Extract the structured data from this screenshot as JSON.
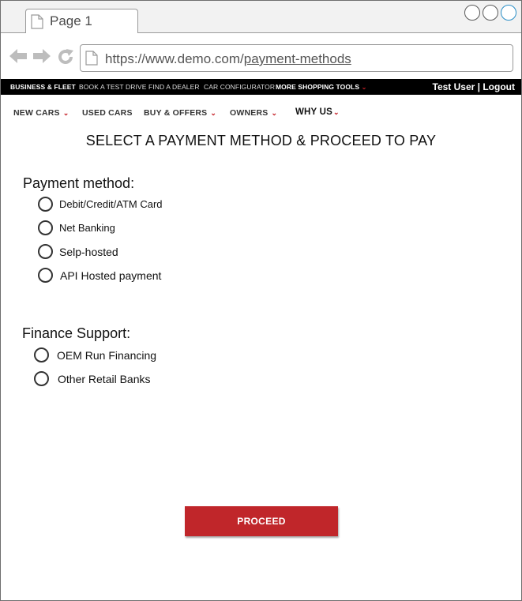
{
  "browser": {
    "tab_title": "Page 1",
    "url_base": "https://www.demo.com/",
    "url_path": "payment-methods"
  },
  "topbar": {
    "items": [
      "BUSINESS & FLEET",
      "BOOK A TEST DRIVE",
      "FIND A DEALER",
      "CAR CONFIGURATOR",
      "MORE SHOPPING TOOLS"
    ],
    "user": "Test User | Logout"
  },
  "nav": {
    "items": [
      "NEW CARS",
      "USED CARS",
      "BUY & OFFERS",
      "OWNERS",
      "WHY US"
    ]
  },
  "page": {
    "title": "SELECT A PAYMENT METHOD & PROCEED TO PAY"
  },
  "payment": {
    "label": "Payment method:",
    "options": [
      "Debit/Credit/ATM Card",
      "Net Banking",
      "Selp-hosted",
      "API Hosted payment"
    ]
  },
  "finance": {
    "label": "Finance Support:",
    "options": [
      "OEM Run Financing",
      "Other Retail Banks"
    ]
  },
  "actions": {
    "proceed_label": "PROCEED"
  },
  "colors": {
    "brand_red": "#c0262a",
    "topbar_bg": "#000000"
  }
}
